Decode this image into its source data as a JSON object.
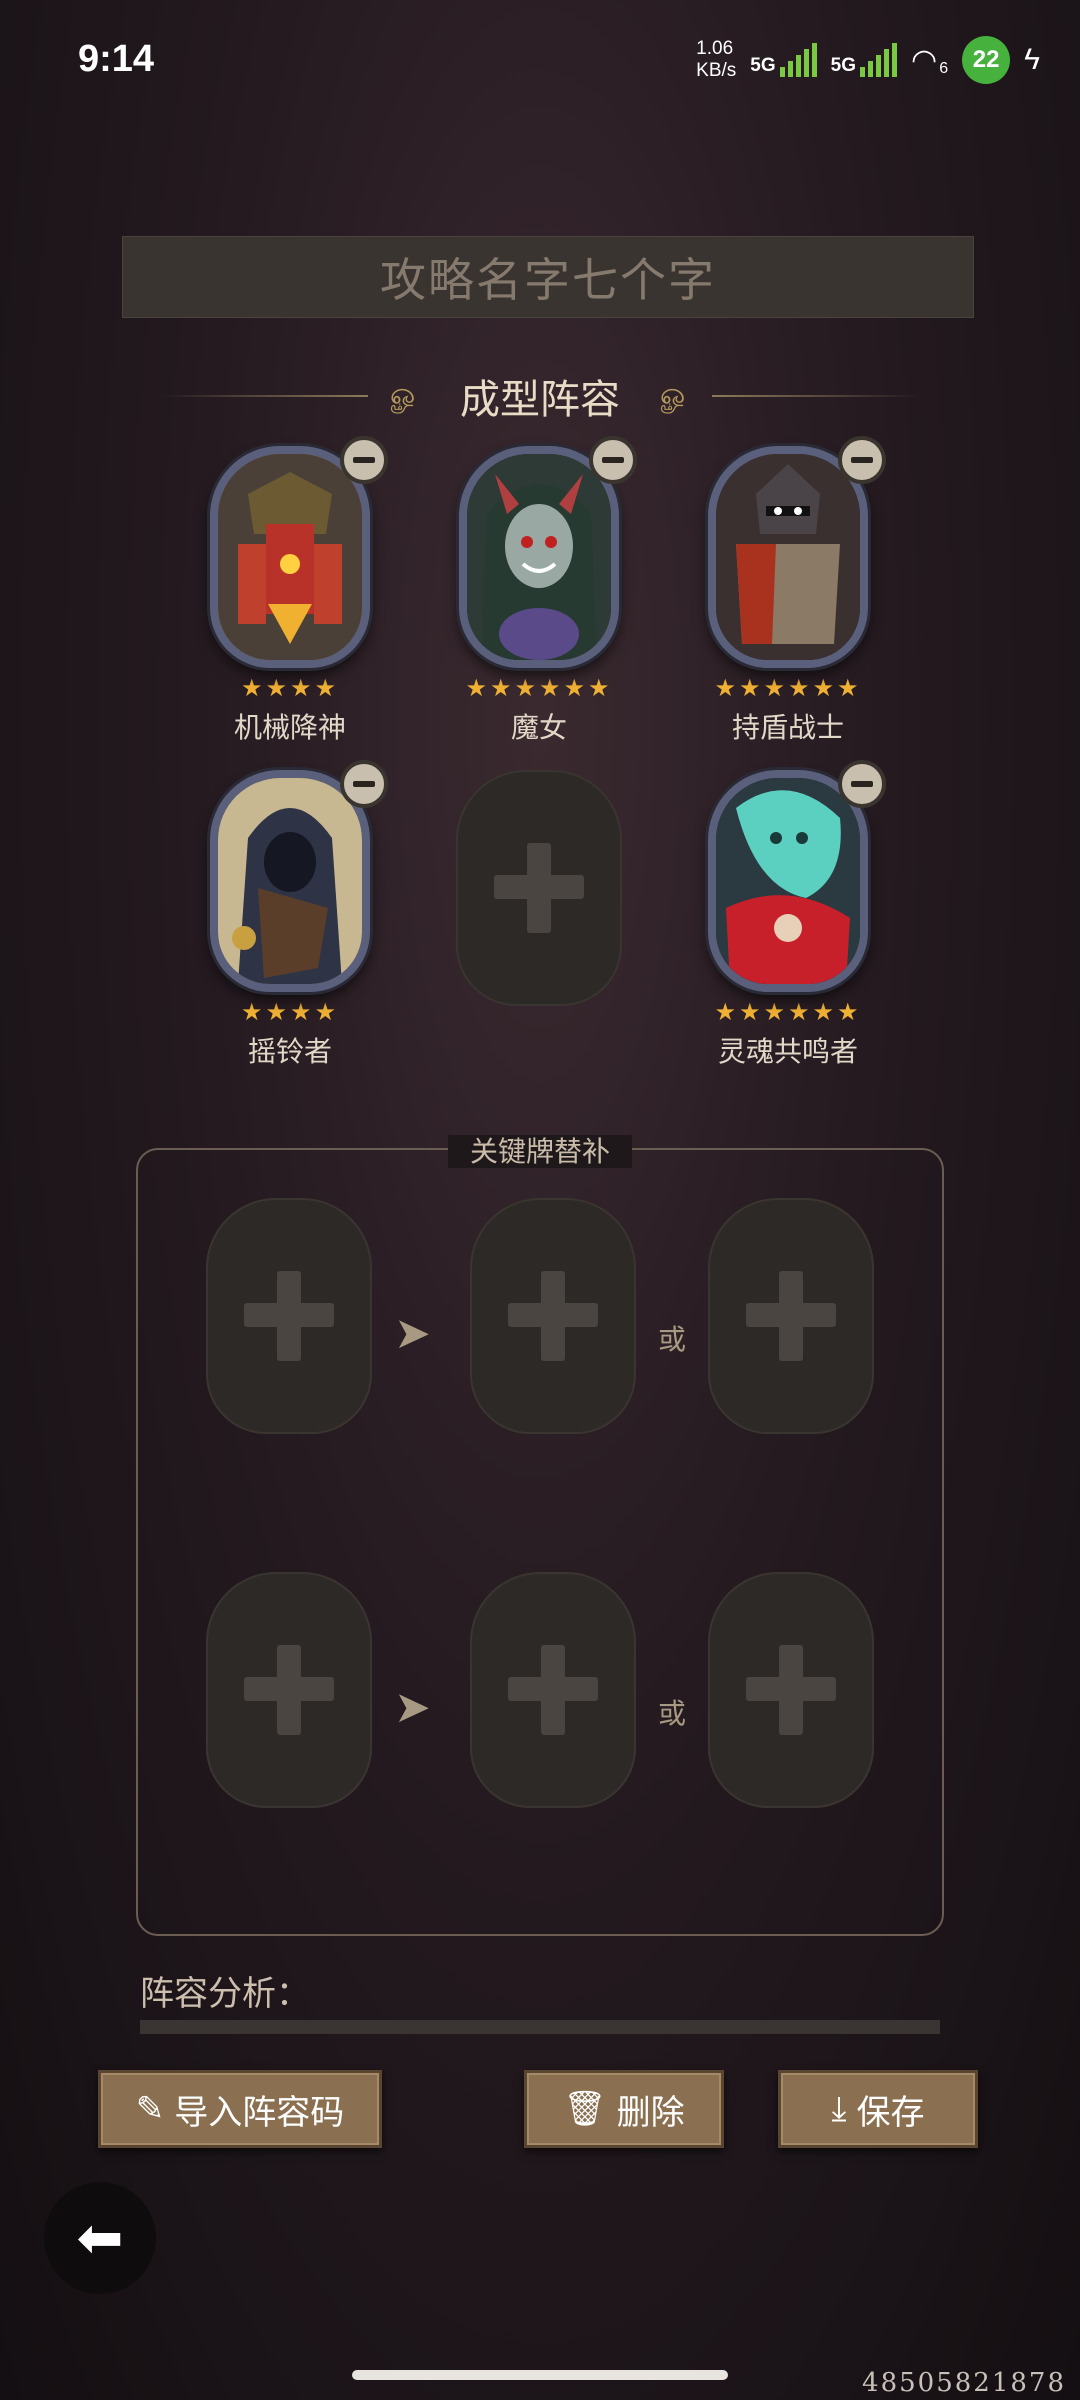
{
  "status": {
    "time": "9:14",
    "speed_top": "1.06",
    "speed_unit": "KB/s",
    "net1": "5G",
    "net2": "5G",
    "wifi_num": "6",
    "battery": "22"
  },
  "title_placeholder": "攻略名字七个字",
  "lineup": {
    "title": "成型阵容",
    "heroes": [
      {
        "name": "机械降神",
        "stars": "★★★★",
        "art": "mech-deus-portrait"
      },
      {
        "name": "魔女",
        "stars": "★★★★★★",
        "art": "witch-portrait"
      },
      {
        "name": "持盾战士",
        "stars": "★★★★★★",
        "art": "shield-warrior-portrait"
      },
      {
        "name": "摇铃者",
        "stars": "★★★★",
        "art": "bell-ringer-portrait"
      },
      {
        "name": "",
        "stars": "",
        "art": "empty-slot"
      },
      {
        "name": "灵魂共鸣者",
        "stars": "★★★★★★",
        "art": "soul-resonator-portrait"
      }
    ]
  },
  "key_cards": {
    "title": "关键牌替补",
    "or_label": "或"
  },
  "analysis_label": "阵容分析：",
  "buttons": {
    "import": "导入阵容码",
    "delete": "删除",
    "save": "保存"
  },
  "uid": "48505821878",
  "colors": {
    "accent_gold": "#f0b034",
    "button": "#8a7050"
  }
}
